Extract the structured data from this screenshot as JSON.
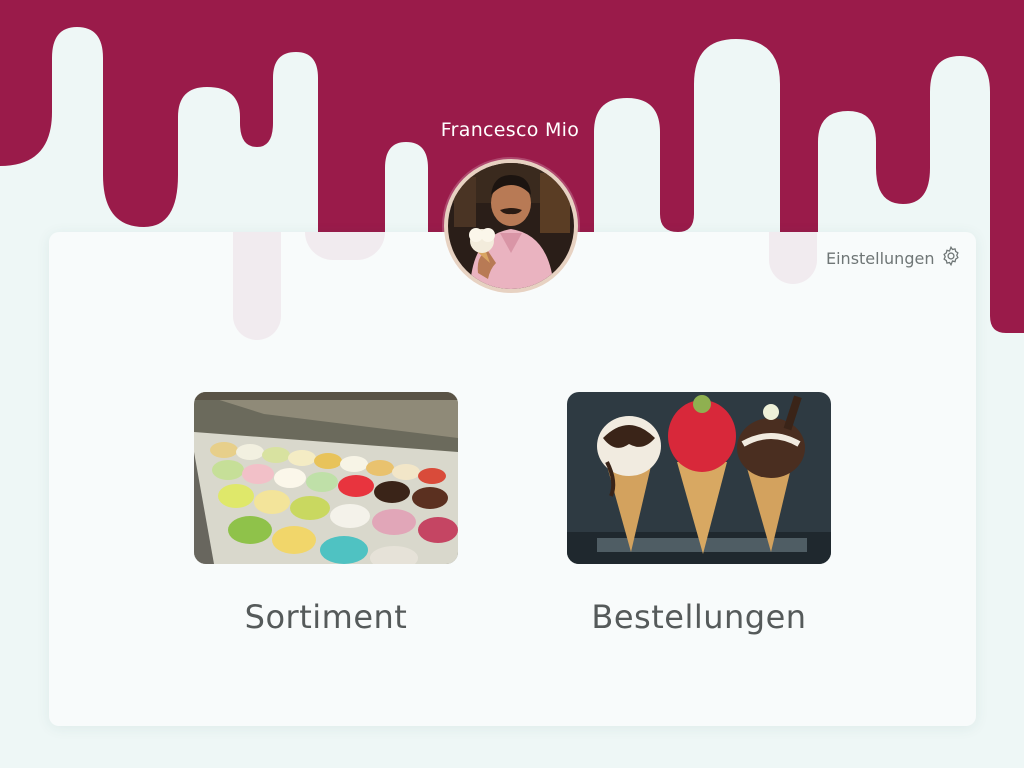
{
  "header": {
    "user_name": "Francesco Mio",
    "avatar_name": "avatar"
  },
  "settings": {
    "label": "Einstellungen",
    "icon": "gear-icon"
  },
  "tiles": [
    {
      "label": "Sortiment",
      "image": "gelato-display-image"
    },
    {
      "label": "Bestellungen",
      "image": "ice-cream-cones-image"
    }
  ],
  "colors": {
    "brand": "#9a1b4a",
    "page_bg": "#eef7f6",
    "card_bg": "#f8fbfb",
    "text_muted": "#6f7676",
    "text_label": "#555a5a"
  }
}
